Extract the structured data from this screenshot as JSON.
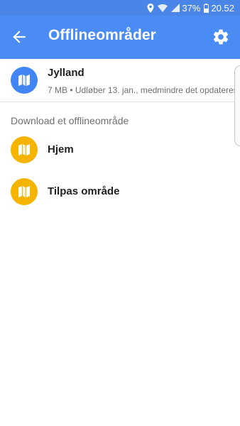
{
  "status_bar": {
    "battery": "37%",
    "time": "20.52",
    "icons": [
      "location-icon",
      "wifi-icon",
      "signal-icon",
      "battery-icon"
    ]
  },
  "app_bar": {
    "title": "Offlineområder",
    "back_icon": "arrow-back-icon",
    "settings_icon": "gear-icon",
    "color": "#4b8bf4"
  },
  "downloaded": [
    {
      "name": "Jylland",
      "details": "7 MB • Udløber 13. jan., medmindre det opdateres",
      "icon": "map-icon",
      "color": "#4285f4"
    }
  ],
  "download_section": {
    "header": "Download et offlineområde",
    "items": [
      {
        "label": "Hjem",
        "icon": "map-icon",
        "color": "#f4b400"
      },
      {
        "label": "Tilpas område",
        "icon": "map-icon",
        "color": "#f4b400"
      }
    ]
  }
}
